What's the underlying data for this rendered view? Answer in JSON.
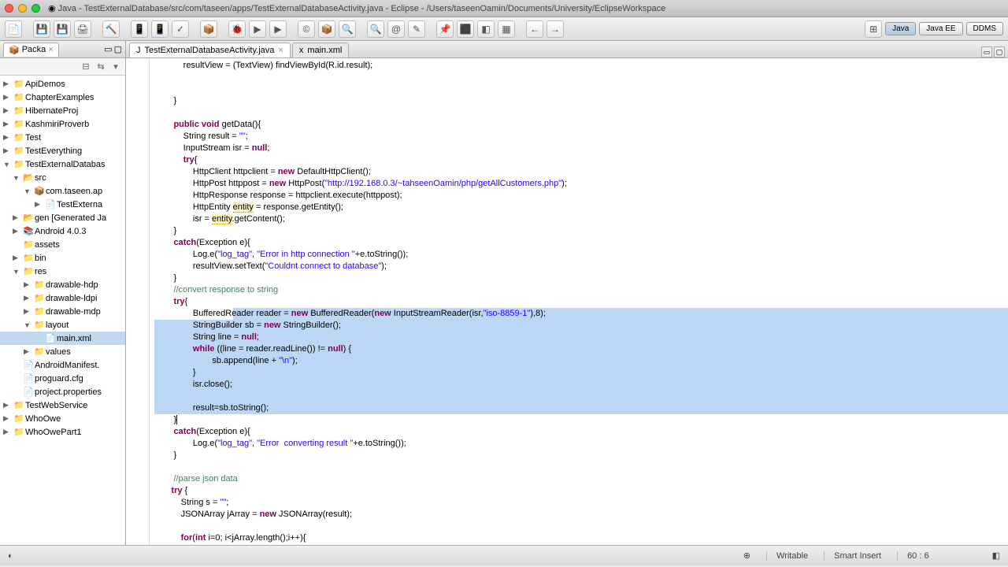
{
  "window_title": "Java - TestExternalDatabase/src/com/taseen/apps/TestExternalDatabaseActivity.java - Eclipse - /Users/taseenOamin/Documents/University/EclipseWorkspace",
  "perspectives": [
    "Java",
    "Java EE",
    "DDMS"
  ],
  "package_explorer": {
    "title": "Packa",
    "items": [
      {
        "label": "ApiDemos",
        "depth": 0,
        "arrow": "▶",
        "icon": "📁"
      },
      {
        "label": "ChapterExamples",
        "depth": 0,
        "arrow": "▶",
        "icon": "📁"
      },
      {
        "label": "HibernateProj",
        "depth": 0,
        "arrow": "▶",
        "icon": "📁"
      },
      {
        "label": "KashmiriProverb",
        "depth": 0,
        "arrow": "▶",
        "icon": "📁"
      },
      {
        "label": "Test",
        "depth": 0,
        "arrow": "▶",
        "icon": "📁"
      },
      {
        "label": "TestEverything",
        "depth": 0,
        "arrow": "▶",
        "icon": "📁"
      },
      {
        "label": "TestExternalDatabas",
        "depth": 0,
        "arrow": "▼",
        "icon": "📁"
      },
      {
        "label": "src",
        "depth": 1,
        "arrow": "▼",
        "icon": "📂"
      },
      {
        "label": "com.taseen.ap",
        "depth": 2,
        "arrow": "▼",
        "icon": "📦"
      },
      {
        "label": "TestExterna",
        "depth": 3,
        "arrow": "▶",
        "icon": "📄"
      },
      {
        "label": "gen [Generated Ja",
        "depth": 1,
        "arrow": "▶",
        "icon": "📂"
      },
      {
        "label": "Android 4.0.3",
        "depth": 1,
        "arrow": "▶",
        "icon": "📚"
      },
      {
        "label": "assets",
        "depth": 1,
        "arrow": "",
        "icon": "📁"
      },
      {
        "label": "bin",
        "depth": 1,
        "arrow": "▶",
        "icon": "📁"
      },
      {
        "label": "res",
        "depth": 1,
        "arrow": "▼",
        "icon": "📁"
      },
      {
        "label": "drawable-hdp",
        "depth": 2,
        "arrow": "▶",
        "icon": "📁"
      },
      {
        "label": "drawable-ldpi",
        "depth": 2,
        "arrow": "▶",
        "icon": "📁"
      },
      {
        "label": "drawable-mdp",
        "depth": 2,
        "arrow": "▶",
        "icon": "📁"
      },
      {
        "label": "layout",
        "depth": 2,
        "arrow": "▼",
        "icon": "📁"
      },
      {
        "label": "main.xml",
        "depth": 3,
        "arrow": "",
        "icon": "📄",
        "selected": true
      },
      {
        "label": "values",
        "depth": 2,
        "arrow": "▶",
        "icon": "📁"
      },
      {
        "label": "AndroidManifest.",
        "depth": 1,
        "arrow": "",
        "icon": "📄"
      },
      {
        "label": "proguard.cfg",
        "depth": 1,
        "arrow": "",
        "icon": "📄"
      },
      {
        "label": "project.properties",
        "depth": 1,
        "arrow": "",
        "icon": "📄"
      },
      {
        "label": "TestWebService",
        "depth": 0,
        "arrow": "▶",
        "icon": "📁"
      },
      {
        "label": "WhoOwe",
        "depth": 0,
        "arrow": "▶",
        "icon": "📁"
      },
      {
        "label": "WhoOwePart1",
        "depth": 0,
        "arrow": "▶",
        "icon": "📁"
      }
    ]
  },
  "editor_tabs": [
    {
      "label": "TestExternalDatabaseActivity.java",
      "active": true
    },
    {
      "label": "main.xml",
      "active": false
    }
  ],
  "code_lines": [
    {
      "t": "            resultView = (TextView) findViewById(R.id.result);"
    },
    {
      "t": ""
    },
    {
      "t": ""
    },
    {
      "t": "        }"
    },
    {
      "t": ""
    },
    {
      "t": "        public void getData(){",
      "kw": [
        "public",
        "void"
      ]
    },
    {
      "t": "            String result = \"\";",
      "str": [
        "\"\""
      ]
    },
    {
      "t": "            InputStream isr = null;",
      "kw": [
        "null"
      ]
    },
    {
      "t": "            try{",
      "kw": [
        "try"
      ]
    },
    {
      "t": "                HttpClient httpclient = new DefaultHttpClient();",
      "kw": [
        "new"
      ]
    },
    {
      "t": "                HttpPost httppost = new HttpPost(\"http://192.168.0.3/~tahseenOamin/php/getAllCustomers.php\");",
      "kw": [
        "new"
      ],
      "str": [
        "\"http://192.168.0.3/~tahseenOamin/php/getAllCustomers.php\""
      ]
    },
    {
      "t": "                HttpResponse response = httpclient.execute(httppost);"
    },
    {
      "t": "                HttpEntity entity = response.getEntity();",
      "warn": [
        "entity"
      ]
    },
    {
      "t": "                isr = entity.getContent();",
      "warn": [
        "entity"
      ]
    },
    {
      "t": "        }"
    },
    {
      "t": "        catch(Exception e){",
      "kw": [
        "catch"
      ]
    },
    {
      "t": "                Log.e(\"log_tag\", \"Error in http connection \"+e.toString());",
      "str": [
        "\"log_tag\"",
        "\"Error in http connection \""
      ]
    },
    {
      "t": "                resultView.setText(\"Couldnt connect to database\");",
      "str": [
        "\"Couldnt connect to database\""
      ]
    },
    {
      "t": "        }"
    },
    {
      "t": "        //convert response to string",
      "cmt": true
    },
    {
      "t": "        try{",
      "kw": [
        "try"
      ]
    },
    {
      "t": "                BufferedReader reader = new BufferedReader(new InputStreamReader(isr,\"iso-8859-1\"),8);",
      "kw": [
        "new"
      ],
      "str": [
        "\"iso-8859-1\""
      ],
      "hl": true,
      "hlstart": true
    },
    {
      "t": "                StringBuilder sb = new StringBuilder();",
      "kw": [
        "new"
      ],
      "hl": true
    },
    {
      "t": "                String line = null;",
      "kw": [
        "null"
      ],
      "hl": true
    },
    {
      "t": "                while ((line = reader.readLine()) != null) {",
      "kw": [
        "while",
        "null"
      ],
      "hl": true
    },
    {
      "t": "                        sb.append(line + \"\\n\");",
      "str": [
        "\"\\n\""
      ],
      "hl": true
    },
    {
      "t": "                }",
      "hl": true
    },
    {
      "t": "                isr.close();",
      "hl": true
    },
    {
      "t": "",
      "hl": true
    },
    {
      "t": "                result=sb.toString();",
      "hl": true
    },
    {
      "t": "        }|",
      "cursor": true
    },
    {
      "t": "        catch(Exception e){",
      "kw": [
        "catch"
      ]
    },
    {
      "t": "                Log.e(\"log_tag\", \"Error  converting result \"+e.toString());",
      "str": [
        "\"log_tag\"",
        "\"Error  converting result \""
      ]
    },
    {
      "t": "        }"
    },
    {
      "t": ""
    },
    {
      "t": "        //parse json data",
      "cmt": true
    },
    {
      "t": "       try {",
      "kw": [
        "try"
      ]
    },
    {
      "t": "           String s = \"\";",
      "str": [
        "\"\""
      ]
    },
    {
      "t": "           JSONArray jArray = new JSONArray(result);",
      "kw": [
        "new"
      ]
    },
    {
      "t": ""
    },
    {
      "t": "           for(int i=0; i<jArray.length();i++){",
      "kw": [
        "for",
        "int"
      ]
    }
  ],
  "status": {
    "writable": "Writable",
    "insert": "Smart Insert",
    "pos": "60 : 6"
  }
}
